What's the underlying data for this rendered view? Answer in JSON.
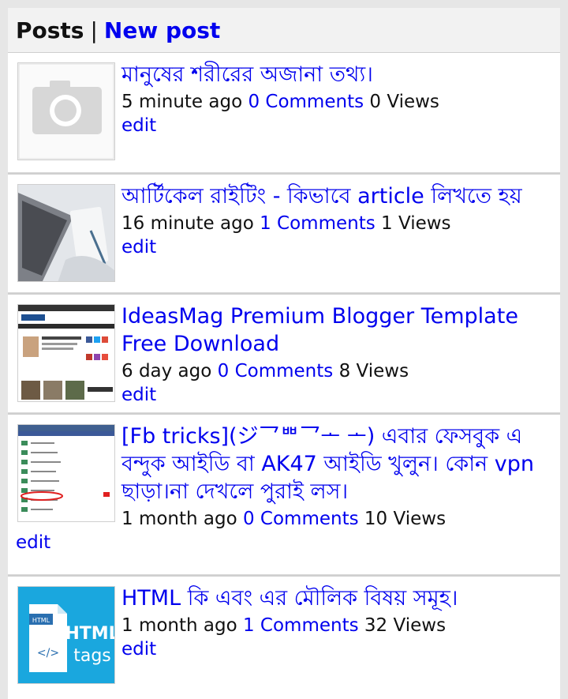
{
  "header": {
    "title": "Posts",
    "separator": "|",
    "new_post": "New post"
  },
  "posts": [
    {
      "title": "মানুষের শরীরের অজানা তথ্য।",
      "time": "5 minute ago",
      "comments": "0 Comments",
      "views": "0 Views",
      "edit": "edit",
      "thumb_icon": "camera-placeholder-icon"
    },
    {
      "title": "আর্টিকেল রাইটিং - কিভাবে article লিখতে হয়",
      "time": "16 minute ago",
      "comments": "1 Comments",
      "views": "1 Views",
      "edit": "edit",
      "thumb_icon": "laptop-notebook-photo"
    },
    {
      "title": "IdeasMag Premium Blogger Template Free Download",
      "time": "6 day ago",
      "comments": "0 Comments",
      "views": "8 Views",
      "edit": "edit",
      "thumb_icon": "template-screenshot"
    },
    {
      "title": "[Fb tricks](ジ乛ᄈ乛ᅩ ᅩ) এবার ফেসবুক এ বন্দুক আইডি বা AK47 আইডি খুলুন। কোন vpn ছাড়া।না দেখলে পুরাই লস।",
      "time": "1 month ago",
      "comments": "0 Comments",
      "views": "10 Views",
      "edit": "edit",
      "thumb_icon": "phone-menu-screenshot"
    },
    {
      "title": "HTML কি এবং এর মৌলিক বিষয় সমূহ।",
      "time": "1 month ago",
      "comments": "1 Comments",
      "views": "32 Views",
      "edit": "edit",
      "thumb_icon": "html-tags-icon",
      "thumb_text": "HTML",
      "thumb_subtext": "tags"
    }
  ]
}
